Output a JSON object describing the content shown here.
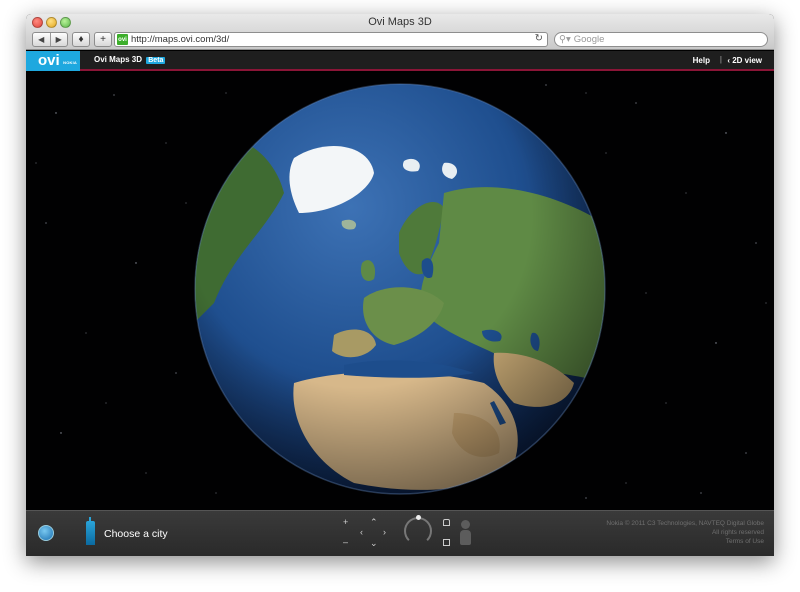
{
  "browser": {
    "window_title": "Ovi Maps 3D",
    "url": "http://maps.ovi.com/3d/",
    "favicon_text": "ovi",
    "search_placeholder": "Google",
    "back_icon": "back-arrow-icon",
    "forward_icon": "forward-arrow-icon"
  },
  "app": {
    "logo_text": "ovi",
    "logo_sub": "NOKIA",
    "title": "Ovi Maps 3D",
    "badge": "Beta",
    "help_link": "Help",
    "separator": "|",
    "view_toggle": "‹ 2D view",
    "accent_color": "#1ea8df",
    "header_rule_color": "#8a1537"
  },
  "controls": {
    "choose_city": "Choose a city",
    "zoom_in": "+",
    "zoom_out": "–"
  },
  "credits": {
    "line1": "Nokia © 2011 C3 Technologies, NAVTEQ Digital Globe",
    "line2": "All rights reserved",
    "line3": "Terms of Use"
  }
}
